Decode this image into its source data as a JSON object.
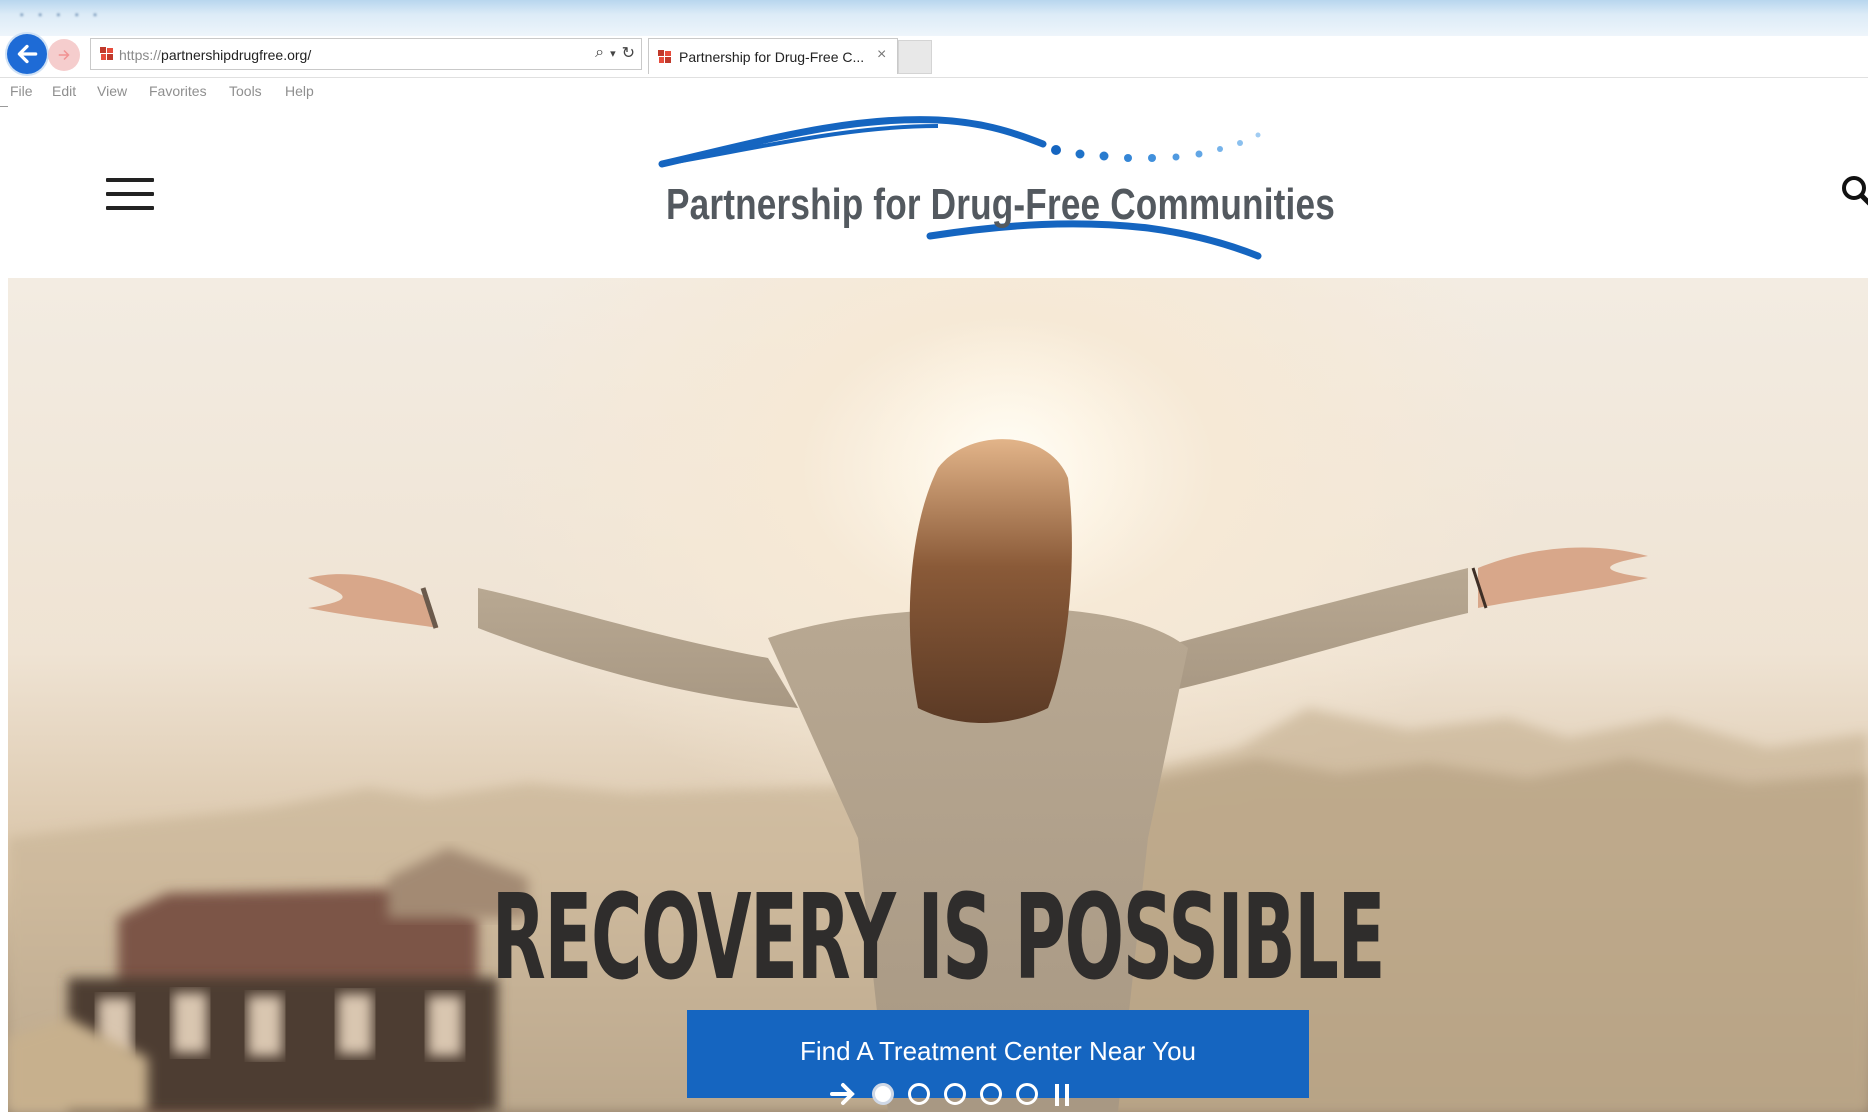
{
  "browser": {
    "url_protocol": "https://",
    "url_host": "partnershipdrugfree.org/",
    "tab_title": "Partnership for Drug-Free C...",
    "tab_close": "×",
    "menu": [
      "File",
      "Edit",
      "View",
      "Favorites",
      "Tools",
      "Help"
    ],
    "search_glyph": "⌕",
    "dropdown_glyph": "▾",
    "refresh_glyph": "↻"
  },
  "site": {
    "logo_text": "Partnership for Drug-Free Communities",
    "brand_colors": {
      "primary_blue": "#1565c0",
      "logo_gray": "#53595f"
    }
  },
  "hero": {
    "headline": "RECOVERY IS POSSIBLE",
    "cta_label": "Find A Treatment Center Near You",
    "slides": 5,
    "active_slide": 1
  },
  "icons": {
    "back": "back-arrow-icon",
    "forward": "forward-icon",
    "menu": "hamburger-icon",
    "search": "search-icon",
    "next": "chevron-right-icon",
    "pause": "pause-icon"
  }
}
